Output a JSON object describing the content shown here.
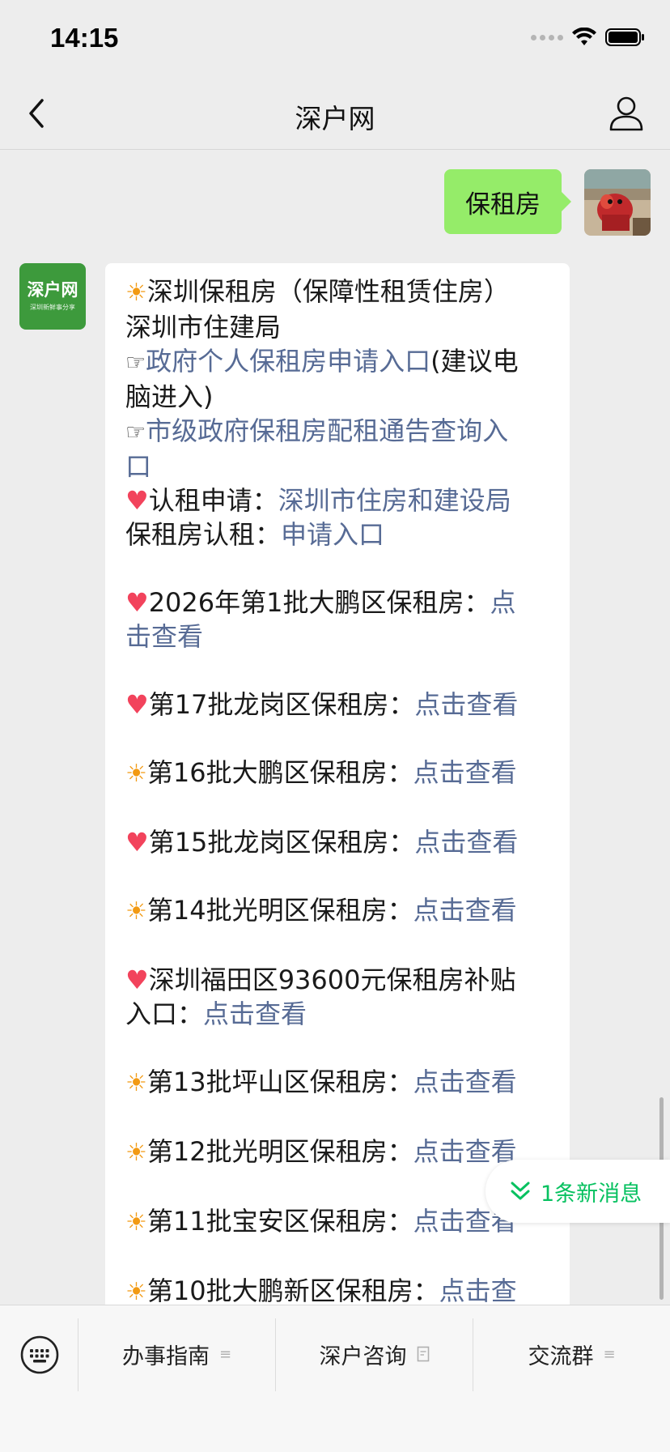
{
  "status_bar": {
    "time": "14:15"
  },
  "nav": {
    "title": "深户网"
  },
  "chat": {
    "my_message": "保租房",
    "bot_avatar": {
      "logo_main": "深户网",
      "logo_sub": "深圳新鲜事分享"
    },
    "reply": {
      "l1": "深圳保租房（保障性租赁住房）",
      "l2": "深圳市住建局",
      "l3_link": "政府个人保租房申请入口",
      "l3_rest": "(建议电",
      "l4": "脑进入)",
      "l5_link": "市级政府保租房配租通告查询入",
      "l6_link": "口",
      "l7_text": "认租申请：",
      "l7_link": "深圳市住房和建设局",
      "l8_text": "保租房认租：",
      "l8_link": "申请入口",
      "l9_text": "2026年第1批大鹏区保租房：",
      "l9_link": "点",
      "l10_link": "击查看",
      "l11_text": "第17批龙岗区保租房：",
      "l11_link": "点击查看",
      "l12_text": "第16批大鹏区保租房：",
      "l12_link": "点击查看",
      "l13_text": "第15批龙岗区保租房：",
      "l13_link": "点击查看",
      "l14_text": "第14批光明区保租房：",
      "l14_link": "点击查看",
      "l15_text": "深圳福田区93600元保租房补贴",
      "l16_text": "入口：",
      "l16_link": "点击查看",
      "l17_text": "第13批坪山区保租房：",
      "l17_link": "点击查看",
      "l18_text": "第12批光明区保租房：",
      "l18_link": "点击查看",
      "l19_text": "第11批宝安区保租房：",
      "l19_link": "点击查看",
      "l20_text": "第10批大鹏新区保租房：",
      "l20_link": "点击查"
    },
    "new_message_pill": "1条新消息"
  },
  "bottom_menu": {
    "items": [
      "办事指南",
      "深户咨询",
      "交流群"
    ]
  },
  "icons": {
    "sun": "sun-emoji",
    "heart": "heart-emoji",
    "pointing_hand": "pointing-hand-emoji"
  },
  "colors": {
    "link": "#576b95",
    "my_bubble": "#95ec69",
    "accent_green": "#07c160"
  }
}
